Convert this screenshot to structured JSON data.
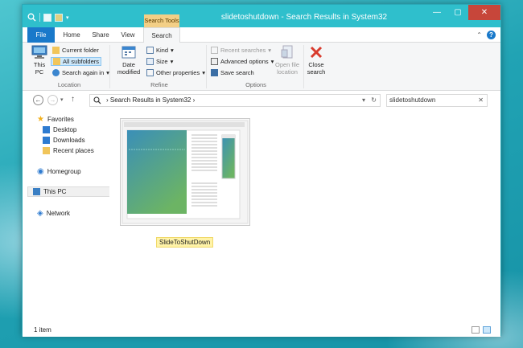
{
  "window": {
    "title": "slidetoshutdown - Search Results in System32",
    "contextual_tab": "Search Tools",
    "buttons": {
      "minimize": "—",
      "maximize": "▢",
      "close": "✕"
    }
  },
  "tabs": [
    "File",
    "Home",
    "Share",
    "View",
    "Search"
  ],
  "ribbon": {
    "location": {
      "this_pc": "This PC",
      "current_folder": "Current folder",
      "all_subfolders": "All subfolders",
      "search_again_in": "Search again in",
      "label": "Location"
    },
    "refine": {
      "date_modified": "Date modified",
      "kind": "Kind",
      "size": "Size",
      "other_properties": "Other properties",
      "label": "Refine"
    },
    "options": {
      "recent_searches": "Recent searches",
      "advanced_options": "Advanced options",
      "save_search": "Save search",
      "open_file_location": "Open file location",
      "label": "Options"
    },
    "close_search": "Close search"
  },
  "address": {
    "crumb": "Search Results in System32",
    "search_value": "slidetoshutdown"
  },
  "nav": {
    "favorites": "Favorites",
    "desktop": "Desktop",
    "downloads": "Downloads",
    "recent_places": "Recent places",
    "homegroup": "Homegroup",
    "this_pc": "This PC",
    "network": "Network"
  },
  "content": {
    "file_name": "SlideToShutDown"
  },
  "status": {
    "item_count": "1 item"
  },
  "colors": {
    "titlebar": "#2fbfcc",
    "file_tab": "#1979ca",
    "search_tools": "#f3cf86",
    "close_button": "#c7463a",
    "highlight": "#fff3a8"
  }
}
